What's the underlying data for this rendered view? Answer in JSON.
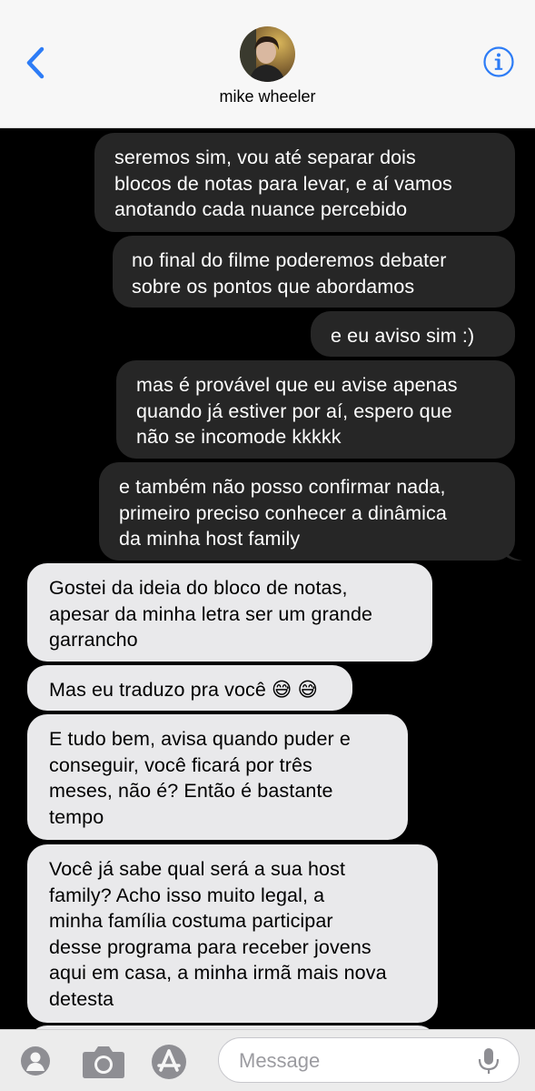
{
  "header": {
    "contact_name": "mike wheeler",
    "back_icon": "chevron-left-icon",
    "info_icon": "info-icon",
    "accent": "#2d7cf6"
  },
  "messages": [
    {
      "type": "sent",
      "text": "seremos sim, vou até separar dois\nblocos de notas para levar, e aí vamos\nanotando cada nuance percebido"
    },
    {
      "type": "sent",
      "text": "no final do filme poderemos debater\nsobre os pontos que abordamos"
    },
    {
      "type": "sent",
      "text": "e eu aviso sim :)"
    },
    {
      "type": "sent",
      "text": "mas é provável que eu avise apenas\nquando já estiver por aí, espero que\nnão se incomode kkkkk"
    },
    {
      "type": "sent",
      "text": "e também não posso confirmar nada,\nprimeiro preciso conhecer a dinâmica\nda minha host family"
    },
    {
      "type": "recv",
      "text": "Gostei da ideia do bloco de notas,\napesar da minha letra ser um grande\ngarrancho"
    },
    {
      "type": "recv",
      "text": "Mas eu traduzo pra você 😅 😅"
    },
    {
      "type": "recv",
      "text": "E tudo bem, avisa quando puder e\nconseguir, você ficará por três\nmeses, não é? Então é bastante\ntempo"
    },
    {
      "type": "recv",
      "text": "Você já sabe qual será a sua host\nfamily? Acho isso muito legal, a\nminha família costuma participar\ndesse programa para receber jovens\naqui em casa, a minha irmã mais nova\ndetesta"
    }
  ],
  "input_bar": {
    "placeholder": "Message",
    "icons": [
      "apps-icon",
      "camera-icon",
      "app-store-icon",
      "microphone-icon"
    ]
  }
}
